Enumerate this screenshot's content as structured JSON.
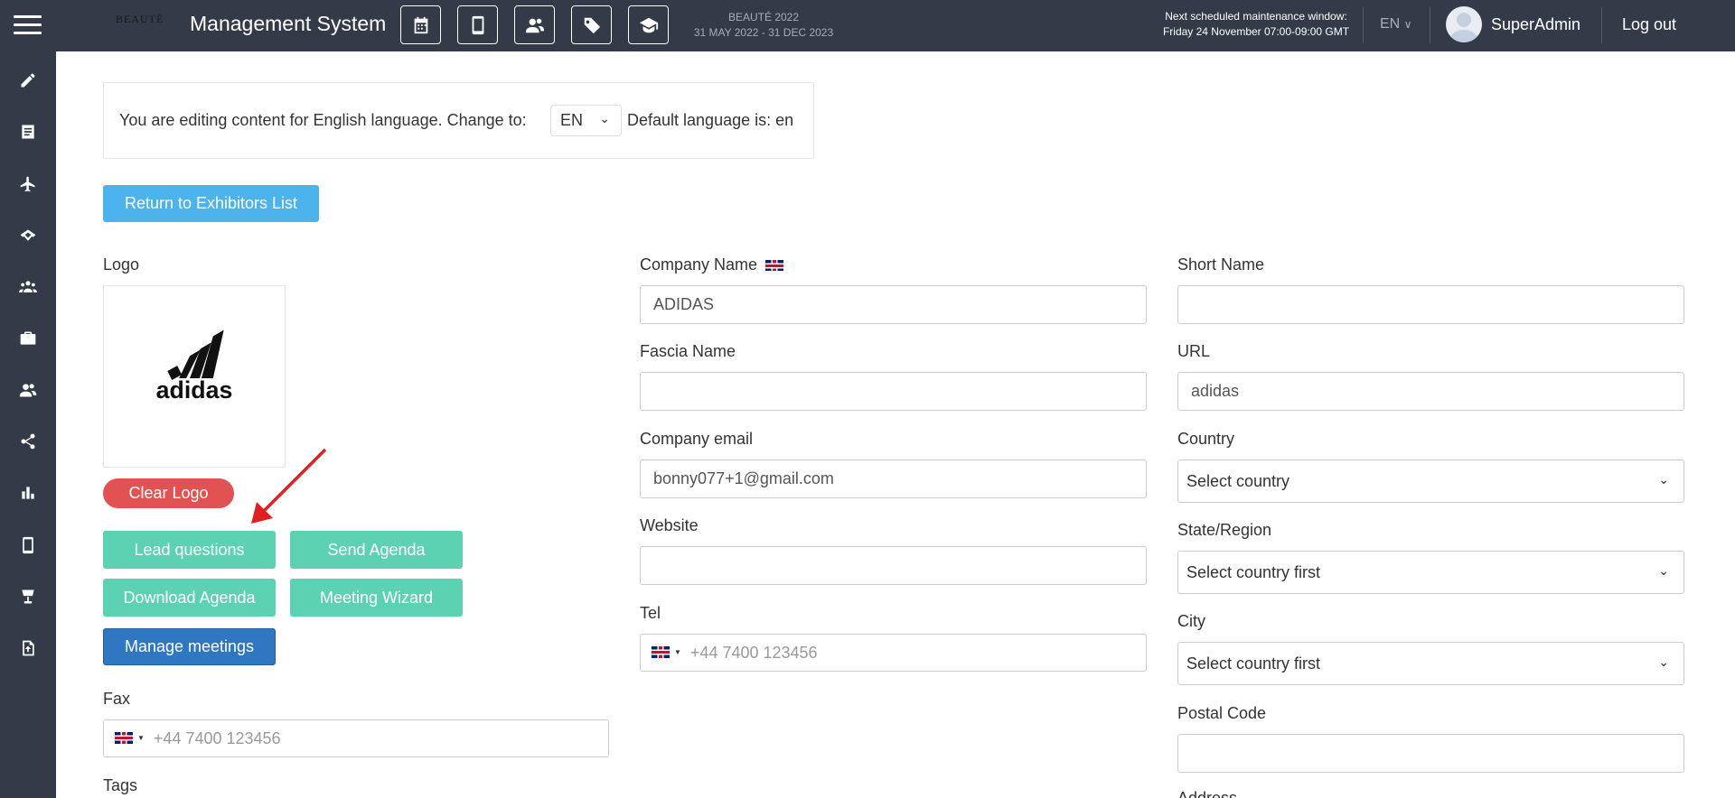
{
  "header": {
    "brand": "BEAUTÉ",
    "title": "Management System",
    "event_name": "BEAUTÉ 2022",
    "event_dates": "31 MAY 2022 - 31 DEC 2023",
    "maintenance_line1": "Next scheduled maintenance window:",
    "maintenance_line2": "Friday 24 November 07:00-09:00 GMT",
    "language": "EN",
    "user_name": "SuperAdmin",
    "logout_label": "Log out",
    "toolbar_icons": [
      "calendar-icon",
      "mobile-icon",
      "users-icon",
      "tag-icon",
      "graduation-cap-icon"
    ]
  },
  "sidebar": {
    "icons": [
      "pencil-icon",
      "list-icon",
      "plane-icon",
      "handshake-icon",
      "group-icon",
      "briefcase-icon",
      "users-icon",
      "share-icon",
      "bar-chart-icon",
      "mobile-icon",
      "booth-icon",
      "file-upload-icon"
    ]
  },
  "language_bar": {
    "text": "You are editing content for English language. Change to:",
    "selected": "EN",
    "default_text": "Default language is: en"
  },
  "return_button": "Return to Exhibitors List",
  "logo_section": {
    "label": "Logo",
    "logo_text": "adidas",
    "clear_button": "Clear Logo"
  },
  "actions": {
    "lead_questions": "Lead questions",
    "send_agenda": "Send Agenda",
    "download_agenda": "Download Agenda",
    "meeting_wizard": "Meeting Wizard",
    "manage_meetings": "Manage meetings"
  },
  "fields": {
    "company_name": {
      "label": "Company Name",
      "value": "ADIDAS"
    },
    "fascia_name": {
      "label": "Fascia Name",
      "value": ""
    },
    "company_email": {
      "label": "Company email",
      "value": "bonny077+1@gmail.com"
    },
    "website": {
      "label": "Website",
      "value": ""
    },
    "tel": {
      "label": "Tel",
      "placeholder": "+44 7400 123456"
    },
    "fax": {
      "label": "Fax",
      "placeholder": "+44 7400 123456"
    },
    "tags": {
      "label": "Tags"
    },
    "short_name": {
      "label": "Short Name",
      "value": ""
    },
    "url": {
      "label": "URL",
      "value": "adidas"
    },
    "country": {
      "label": "Country",
      "selected": "Select country"
    },
    "state": {
      "label": "State/Region",
      "selected": "Select country first"
    },
    "city": {
      "label": "City",
      "selected": "Select country first"
    },
    "postal_code": {
      "label": "Postal Code",
      "value": ""
    },
    "address": {
      "label": "Address"
    }
  },
  "colors": {
    "topbar": "#343a47",
    "primary_blue": "#4db3ec",
    "teal": "#5dd2b2",
    "dark_blue": "#2f77c0",
    "danger": "#e05352",
    "annotation_arrow": "#e02020"
  }
}
